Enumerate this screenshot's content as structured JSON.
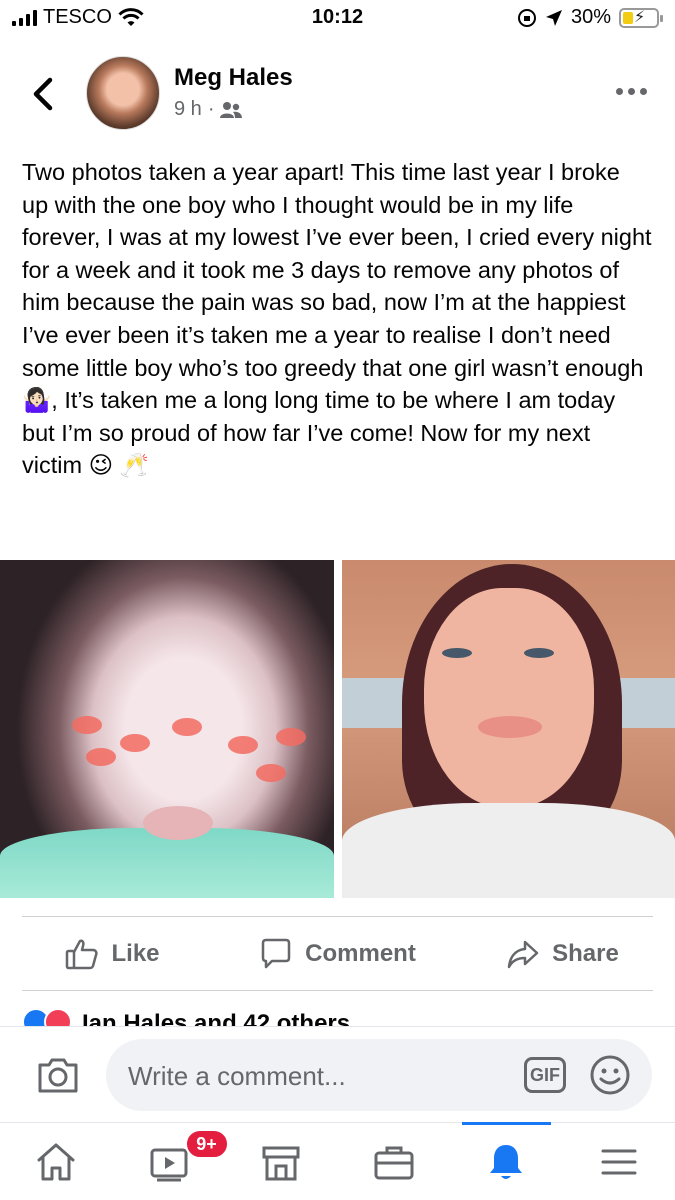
{
  "status_bar": {
    "carrier": "TESCO",
    "time": "10:12",
    "battery": "30%",
    "battery_level": 0.3,
    "icons": [
      "signal-icon",
      "wifi-icon",
      "orientation-lock-icon",
      "location-icon",
      "battery-icon"
    ]
  },
  "post": {
    "author": "Meg Hales",
    "time": "9 h",
    "separator": "·",
    "audience_icon": "friends-icon",
    "text": "Two photos taken a year apart! This time last year I broke up with the one boy who I thought would be in my life forever, I was at my lowest I’ve ever been, I cried every night for a week and it took me 3 days to remove any photos of him because the pain was so bad, now I’m at the happiest I’ve ever been it’s taken me a year to realise I don’t need some little boy who’s too greedy that one girl wasn’t enough🤷🏻‍♀️, It’s taken me a long long time to be where I am today but I’m so proud of how far I’ve come! Now for my next victim 😉 🥂"
  },
  "actions": {
    "like": "Like",
    "comment": "Comment",
    "share": "Share"
  },
  "reactions": {
    "summary": "Ian Hales and 42 others",
    "icons": [
      "like-reaction-icon",
      "love-reaction-icon"
    ]
  },
  "comment_box": {
    "placeholder": "Write a comment...",
    "gif": "GIF"
  },
  "bottom_nav": {
    "items": [
      "home-icon",
      "watch-icon",
      "marketplace-icon",
      "jobs-icon",
      "notifications-icon",
      "menu-icon"
    ],
    "watch_badge": "9+",
    "active": "notifications"
  },
  "colors": {
    "accent": "#1877f2",
    "badge": "#e41e3f",
    "secondary_text": "#65676b"
  }
}
